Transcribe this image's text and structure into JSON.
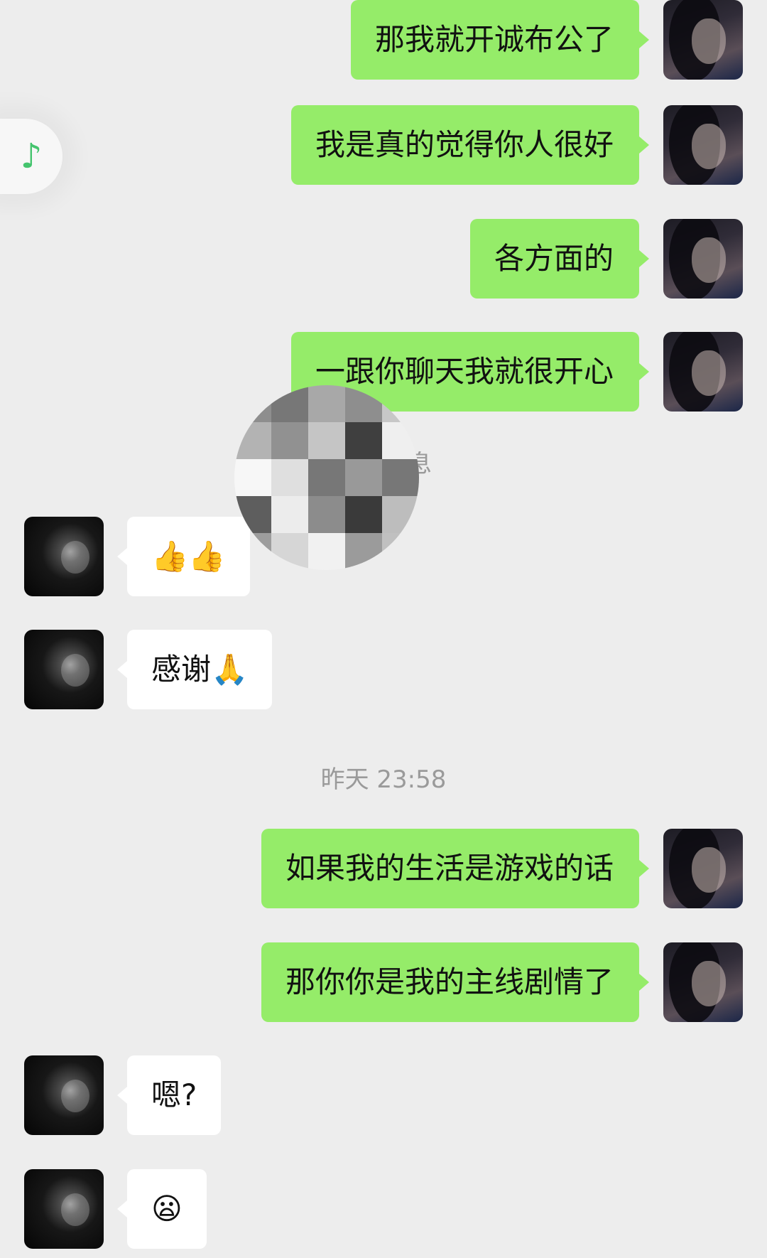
{
  "messages": [
    {
      "side": "right",
      "text": "那我就开诚布公了"
    },
    {
      "side": "right",
      "text": "我是真的觉得你人很好"
    },
    {
      "side": "right",
      "text": "各方面的"
    },
    {
      "side": "right",
      "text": "一跟你聊天我就很开心"
    },
    {
      "side": "left",
      "text": "👍👍"
    },
    {
      "side": "left",
      "text": "感谢🙏"
    },
    {
      "side": "right",
      "text": "如果我的生活是游戏的话"
    },
    {
      "side": "right",
      "text": "那你你是我的主线剧情了"
    },
    {
      "side": "left",
      "text": "嗯?"
    },
    {
      "side": "left",
      "text": "😦"
    }
  ],
  "notice": "一条消息",
  "timestamp": "昨天 23:58",
  "music_icon": "♪",
  "icons": {
    "music": "music-note-icon",
    "mosaic": "blur-mosaic-icon"
  },
  "colors": {
    "chat_background": "#ededed",
    "sent_bubble": "#95ec69",
    "received_bubble": "#ffffff",
    "music_note": "#45c46e"
  }
}
